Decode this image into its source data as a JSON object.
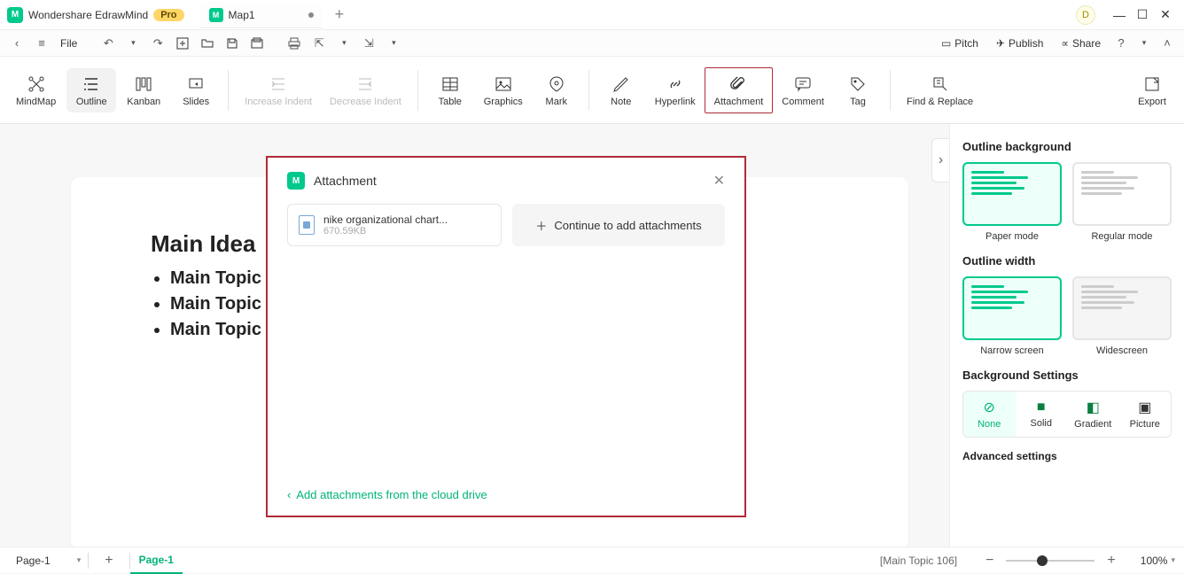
{
  "title": {
    "app": "Wondershare EdrawMind",
    "pro": "Pro",
    "tab": "Map1",
    "user": "D"
  },
  "toolbar": {
    "file": "File",
    "pitch": "Pitch",
    "publish": "Publish",
    "share": "Share"
  },
  "ribbon": {
    "mindmap": "MindMap",
    "outline": "Outline",
    "kanban": "Kanban",
    "slides": "Slides",
    "inc": "Increase Indent",
    "dec": "Decrease Indent",
    "table": "Table",
    "graphics": "Graphics",
    "mark": "Mark",
    "note": "Note",
    "hyperlink": "Hyperlink",
    "attachment": "Attachment",
    "comment": "Comment",
    "tag": "Tag",
    "find": "Find & Replace",
    "export": "Export"
  },
  "content": {
    "mainIdea": "Main Idea",
    "topics": [
      "Main Topic",
      "Main Topic",
      "Main Topic"
    ]
  },
  "modal": {
    "title": "Attachment",
    "file": {
      "name": "nike organizational chart...",
      "size": "670.59KB"
    },
    "addMore": "Continue to add attachments",
    "cloud": "Add attachments from the cloud drive"
  },
  "side": {
    "bg": "Outline background",
    "paper": "Paper mode",
    "regular": "Regular mode",
    "width": "Outline width",
    "narrow": "Narrow screen",
    "wide": "Widescreen",
    "bgset": "Background Settings",
    "none": "None",
    "solid": "Solid",
    "gradient": "Gradient",
    "picture": "Picture",
    "adv": "Advanced settings"
  },
  "status": {
    "pageSel": "Page-1",
    "pageTab": "Page-1",
    "info": "[Main Topic 106]",
    "zoom": "100%"
  }
}
